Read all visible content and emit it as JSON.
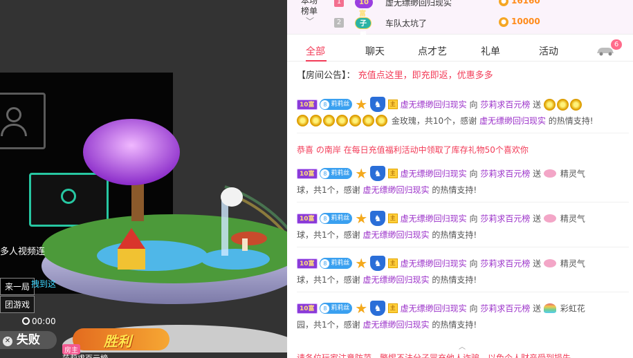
{
  "stage": {
    "label_multi": "多人视频连",
    "label_again": "来一局",
    "label_push": "拽到这",
    "label_game": "团游戏",
    "timer": "00:00",
    "lose_text": "失败",
    "win_text": "胜利",
    "host_tag": "房主",
    "host_name": "莎莉求百元榜"
  },
  "rank": {
    "label_line1": "本场",
    "label_line2": "榜单",
    "rows": [
      {
        "num": "1",
        "badge": "10富",
        "name": "虚无缥缈回归现实",
        "value": "16160"
      },
      {
        "num": "2",
        "badge": "子爵",
        "name": "车队太坑了",
        "value": "10000"
      }
    ]
  },
  "tabs": [
    {
      "label": "全部",
      "active": true
    },
    {
      "label": "聊天"
    },
    {
      "label": "点才艺"
    },
    {
      "label": "礼单"
    },
    {
      "label": "活动"
    }
  ],
  "car_badge": "6",
  "notice": {
    "tag": "【房间公告】：",
    "message": "充值点这里，即充即返，优惠多多"
  },
  "badges": {
    "rich": "10富",
    "fan_level": "8",
    "fan_name": "莉莉丝",
    "host_mark": "主"
  },
  "messages": [
    {
      "sender": "虚无缥缈回归现实",
      "to": "向",
      "target": "莎莉求百元榜",
      "send": "送",
      "gift": "金玫瑰",
      "count_text": "，共10个，感谢",
      "thanks_name": "虚无缥缈回归现实",
      "thanks_tail": "的热情支持!"
    },
    {
      "sender": "虚无缥缈回归现实",
      "to": "向",
      "target": "莎莉求百元榜",
      "send": "送",
      "gift": "精灵气",
      "gift_cont": "球",
      "count_text": "，共1个，感谢",
      "thanks_name": "虚无缥缈回归现实",
      "thanks_tail": "的热情支持!"
    },
    {
      "sender": "虚无缥缈回归现实",
      "to": "向",
      "target": "莎莉求百元榜",
      "send": "送",
      "gift": "精灵气",
      "gift_cont": "球",
      "count_text": "，共1个，感谢",
      "thanks_name": "虚无缥缈回归现实",
      "thanks_tail": "的热情支持!"
    },
    {
      "sender": "虚无缥缈回归现实",
      "to": "向",
      "target": "莎莉求百元榜",
      "send": "送",
      "gift": "精灵气",
      "gift_cont": "球",
      "count_text": "，共1个，感谢",
      "thanks_name": "虚无缥缈回归现实",
      "thanks_tail": "的热情支持!"
    },
    {
      "sender": "虚无缥缈回归现实",
      "to": "向",
      "target": "莎莉求百元榜",
      "send": "送",
      "gift": "彩虹花",
      "gift_cont": "园",
      "count_text": "，共1个，感谢",
      "thanks_name": "虚无缥缈回归现实",
      "thanks_tail": "的热情支持!"
    }
  ],
  "system_msg": "恭喜 の南岸 在每日充值福利活动中领取了库存礼物50个喜欢你",
  "footer_warning": "请各位玩家注意防范，警惕不法分子冒充他人诈骗，以免个人财产受到损失。"
}
